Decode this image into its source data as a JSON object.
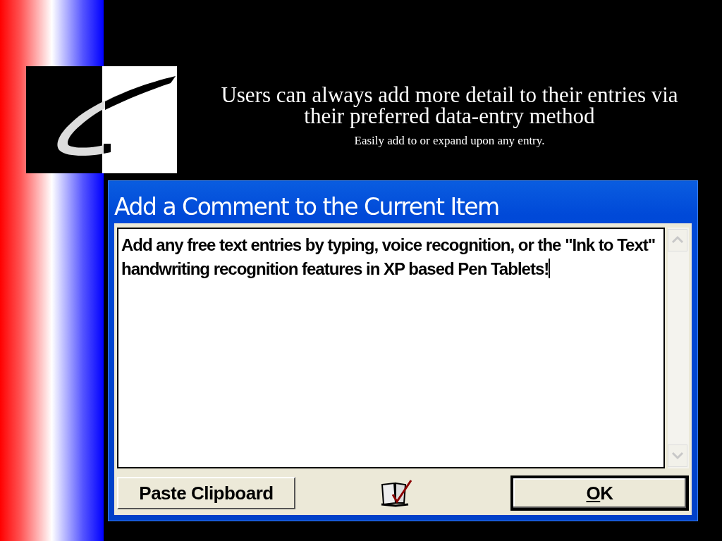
{
  "slide": {
    "title": "Users can always add more detail to their entries via their preferred data-entry method",
    "subtitle": "Easily add to or expand upon any entry."
  },
  "dialog": {
    "title": "Add a Comment to the Current Item",
    "comment": {
      "value": "Add any free text entries by typing, voice recognition, or the \"Ink to Text\" handwriting recognition features in XP based Pen Tablets!",
      "caret_visible": true
    },
    "buttons": [
      {
        "label": "Paste Clipboard",
        "default": false
      },
      {
        "label": "OK",
        "default": true
      }
    ]
  }
}
